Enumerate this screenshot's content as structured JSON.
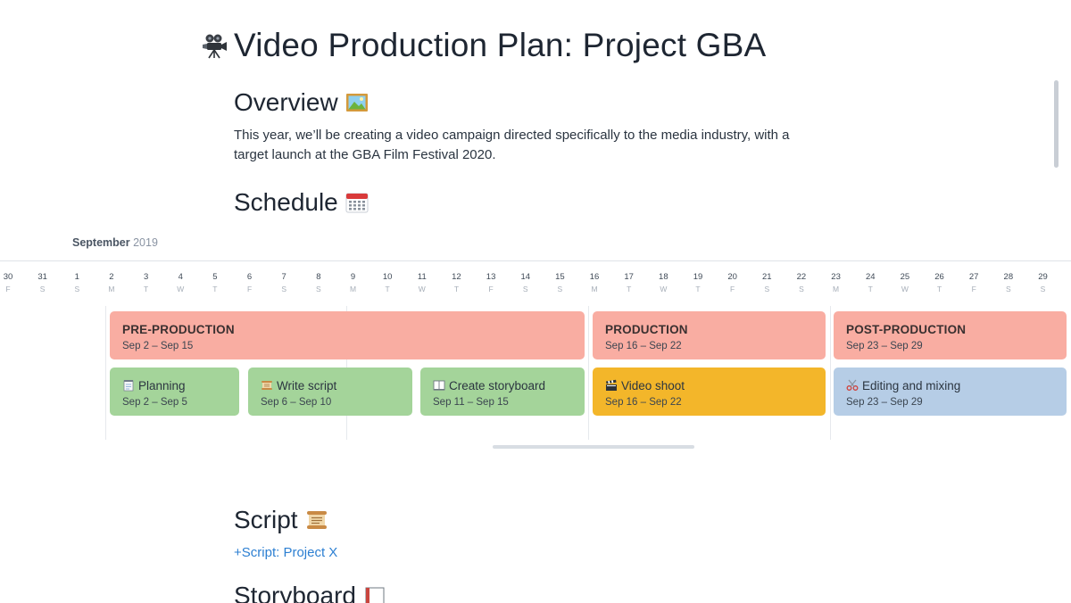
{
  "title": "Video Production Plan: Project GBA",
  "title_icon": "movie-camera-icon",
  "overview": {
    "heading": "Overview",
    "icon": "framed-picture-icon",
    "text": "This year, we’ll be creating a video campaign directed specifically to the media industry, with a target launch at the GBA Film Festival 2020."
  },
  "schedule": {
    "heading": "Schedule",
    "icon": "calendar-icon",
    "month": "September",
    "year": "2019",
    "days": [
      {
        "num": "30",
        "wd": "F"
      },
      {
        "num": "31",
        "wd": "S"
      },
      {
        "num": "1",
        "wd": "S"
      },
      {
        "num": "2",
        "wd": "M"
      },
      {
        "num": "3",
        "wd": "T"
      },
      {
        "num": "4",
        "wd": "W"
      },
      {
        "num": "5",
        "wd": "T"
      },
      {
        "num": "6",
        "wd": "F"
      },
      {
        "num": "7",
        "wd": "S"
      },
      {
        "num": "8",
        "wd": "S"
      },
      {
        "num": "9",
        "wd": "M"
      },
      {
        "num": "10",
        "wd": "T"
      },
      {
        "num": "11",
        "wd": "W"
      },
      {
        "num": "12",
        "wd": "T"
      },
      {
        "num": "13",
        "wd": "F"
      },
      {
        "num": "14",
        "wd": "S"
      },
      {
        "num": "15",
        "wd": "S"
      },
      {
        "num": "16",
        "wd": "M"
      },
      {
        "num": "17",
        "wd": "T"
      },
      {
        "num": "18",
        "wd": "W"
      },
      {
        "num": "19",
        "wd": "T"
      },
      {
        "num": "20",
        "wd": "F"
      },
      {
        "num": "21",
        "wd": "S"
      },
      {
        "num": "22",
        "wd": "S"
      },
      {
        "num": "23",
        "wd": "M"
      },
      {
        "num": "24",
        "wd": "T"
      },
      {
        "num": "25",
        "wd": "W"
      },
      {
        "num": "26",
        "wd": "T"
      },
      {
        "num": "27",
        "wd": "F"
      },
      {
        "num": "28",
        "wd": "S"
      },
      {
        "num": "29",
        "wd": "S"
      }
    ],
    "phases": [
      {
        "title": "PRE-PRODUCTION",
        "dates": "Sep 2 – Sep 15",
        "color": "#f9ada2"
      },
      {
        "title": "PRODUCTION",
        "dates": "Sep 16 – Sep 22",
        "color": "#f9ada2"
      },
      {
        "title": "POST-PRODUCTION",
        "dates": "Sep 23 – Sep 29",
        "color": "#f9ada2"
      }
    ],
    "tasks": [
      {
        "title": "Planning",
        "dates": "Sep 2 – Sep 5",
        "icon": "notepad-icon",
        "color": "#a4d49a"
      },
      {
        "title": "Write script",
        "dates": "Sep 6 – Sep 10",
        "icon": "scroll-icon",
        "color": "#a4d49a"
      },
      {
        "title": "Create storyboard",
        "dates": "Sep 11 – Sep 15",
        "icon": "open-book-icon",
        "color": "#a4d49a"
      },
      {
        "title": "Video shoot",
        "dates": "Sep 16 – Sep 22",
        "icon": "clapper-board-icon",
        "color": "#f3b62a"
      },
      {
        "title": "Editing and mixing",
        "dates": "Sep 23 – Sep 29",
        "icon": "scissors-icon",
        "color": "#b6cde6"
      }
    ]
  },
  "script": {
    "heading": "Script",
    "icon": "scroll-icon",
    "link_prefix": "+",
    "link_text": "Script: Project X"
  },
  "storyboard": {
    "heading": "Storyboard",
    "icon": "book-icon"
  }
}
